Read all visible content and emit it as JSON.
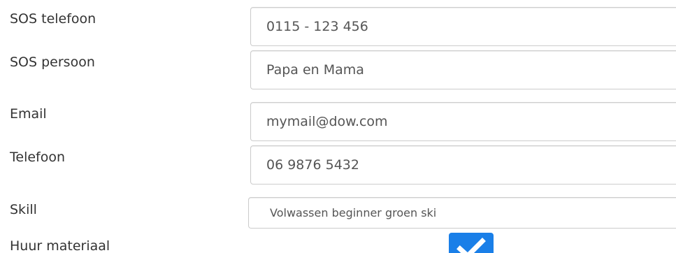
{
  "form": {
    "sos_phone": {
      "label": "SOS telefoon",
      "value": "0115 - 123 456"
    },
    "sos_person": {
      "label": "SOS persoon",
      "value": "Papa en Mama"
    },
    "email": {
      "label": "Email",
      "value": "mymail@dow.com"
    },
    "phone": {
      "label": "Telefoon",
      "value": "06 9876 5432"
    },
    "skill": {
      "label": "Skill",
      "selected": "Volwassen beginner groen ski"
    },
    "rental": {
      "label": "Huur materiaal",
      "checked": true,
      "icon": "check-icon",
      "accent_color": "#1a7fe8"
    }
  }
}
